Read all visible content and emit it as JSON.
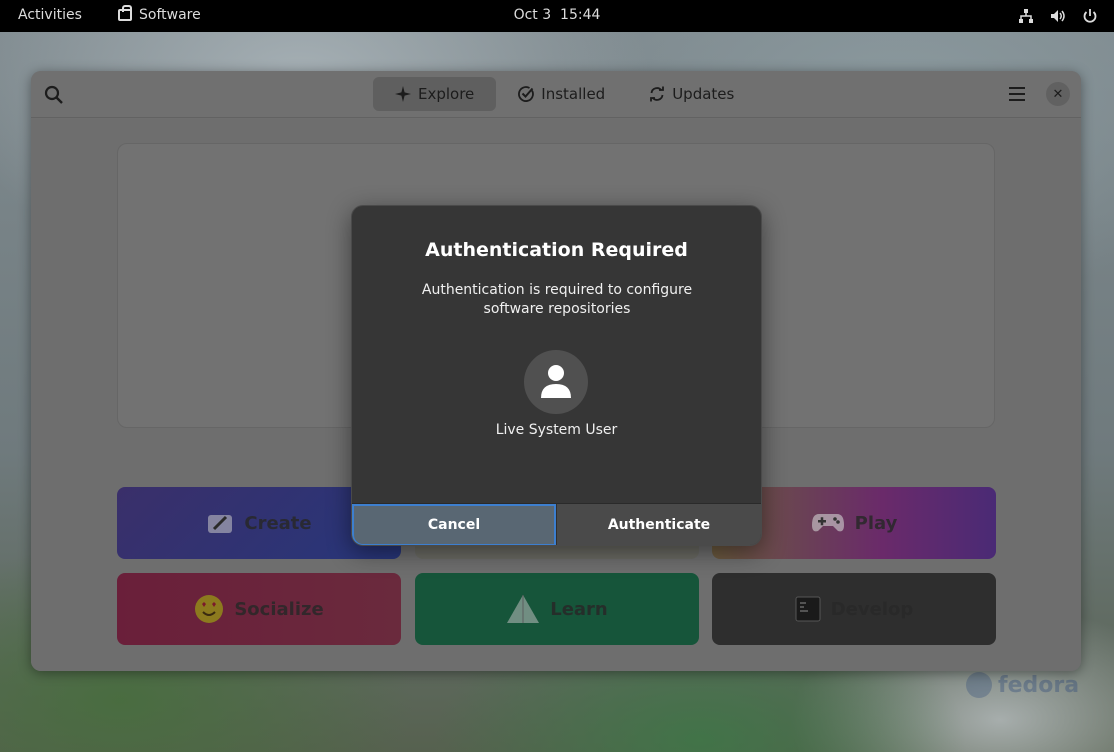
{
  "topbar": {
    "activities": "Activities",
    "app_name": "Software",
    "clock": "Oct 3  15:44",
    "status_icons": [
      "network-icon",
      "volume-icon",
      "power-icon"
    ]
  },
  "window": {
    "tabs": [
      {
        "label": "Explore",
        "icon": "explore-star-icon",
        "active": true
      },
      {
        "label": "Installed",
        "icon": "checkmark-circle-icon",
        "active": false
      },
      {
        "label": "Updates",
        "icon": "refresh-icon",
        "active": false
      }
    ],
    "categories": [
      {
        "label": "Create",
        "icon": "create-icon"
      },
      {
        "label": "Play",
        "icon": "gamepad-icon"
      },
      {
        "label": "Socialize",
        "icon": "emoji-icon"
      },
      {
        "label": "Learn",
        "icon": "learn-icon"
      },
      {
        "label": "Develop",
        "icon": "terminal-icon"
      }
    ]
  },
  "dialog": {
    "title": "Authentication Required",
    "message": "Authentication is required to configure software repositories",
    "user": "Live System User",
    "cancel_label": "Cancel",
    "authenticate_label": "Authenticate"
  },
  "wallpaper": {
    "watermark": "fedora"
  },
  "colors": {
    "accent": "#3d7fcf",
    "dialog_bg": "#363636",
    "topbar_bg": "#000000"
  }
}
